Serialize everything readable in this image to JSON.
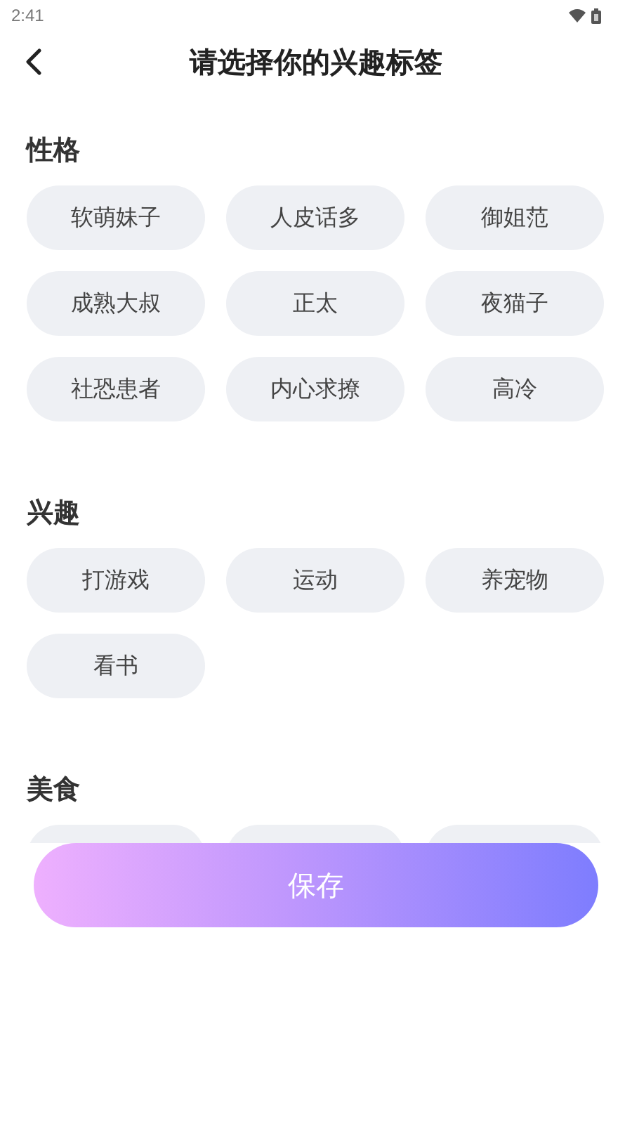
{
  "status_bar": {
    "time": "2:41"
  },
  "header": {
    "title": "请选择你的兴趣标签"
  },
  "sections": [
    {
      "title": "性格",
      "tags": [
        {
          "kind": "label",
          "label": "软萌妹子"
        },
        {
          "kind": "label",
          "label": "人皮话多"
        },
        {
          "kind": "label",
          "label": "御姐范"
        },
        {
          "kind": "label",
          "label": "成熟大叔"
        },
        {
          "kind": "label",
          "label": "正太"
        },
        {
          "kind": "label",
          "label": "夜猫子"
        },
        {
          "kind": "label",
          "label": "社恐患者"
        },
        {
          "kind": "label",
          "label": "内心求撩"
        },
        {
          "kind": "label",
          "label": "高冷"
        }
      ]
    },
    {
      "title": "兴趣",
      "tags": [
        {
          "kind": "label",
          "label": "打游戏"
        },
        {
          "kind": "label",
          "label": "运动"
        },
        {
          "kind": "label",
          "label": "养宠物"
        },
        {
          "kind": "label",
          "label": "看书"
        }
      ]
    },
    {
      "title": "美食",
      "tags": [
        {
          "kind": "cut"
        },
        {
          "kind": "cut"
        },
        {
          "kind": "cut"
        }
      ]
    }
  ],
  "save_button": {
    "label": "保存"
  }
}
